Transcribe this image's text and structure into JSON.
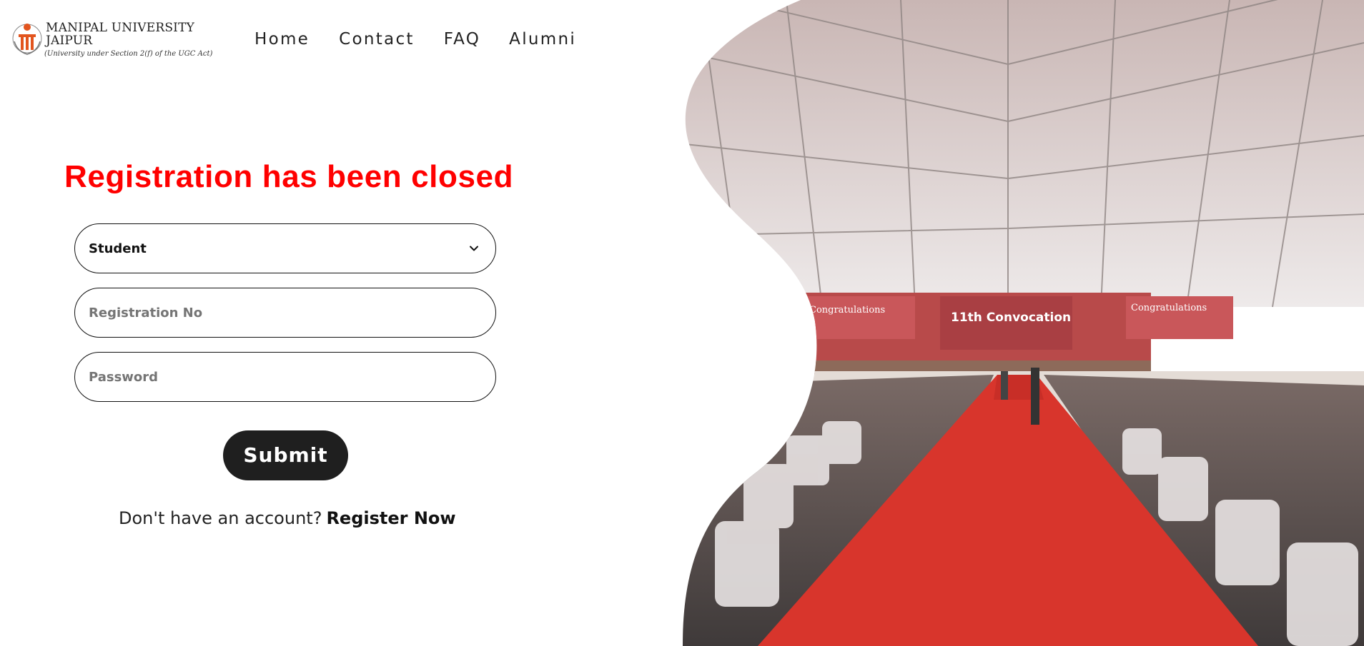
{
  "header": {
    "logo": {
      "name_line1": "MANIPAL UNIVERSITY",
      "name_line2": "JAIPUR",
      "subtitle": "(University under Section 2(f) of the UGC Act)"
    },
    "nav": [
      "Home",
      "Contact",
      "FAQ",
      "Alumni"
    ]
  },
  "form": {
    "closed_message": "Registration has been closed",
    "user_type": {
      "selected": "Student"
    },
    "registration_no": {
      "placeholder": "Registration No"
    },
    "password": {
      "placeholder": "Password"
    },
    "submit_label": "Submit",
    "signup_prompt": "Don't have an account?",
    "signup_link": "Register Now"
  },
  "hero_photo": {
    "banner_left": "Congratulations",
    "banner_center": "11th Convocation",
    "banner_right": "Congratulations"
  },
  "colors": {
    "alert": "#ff0000",
    "button_bg": "#1f1f1f",
    "carpet": "#d8352c"
  }
}
